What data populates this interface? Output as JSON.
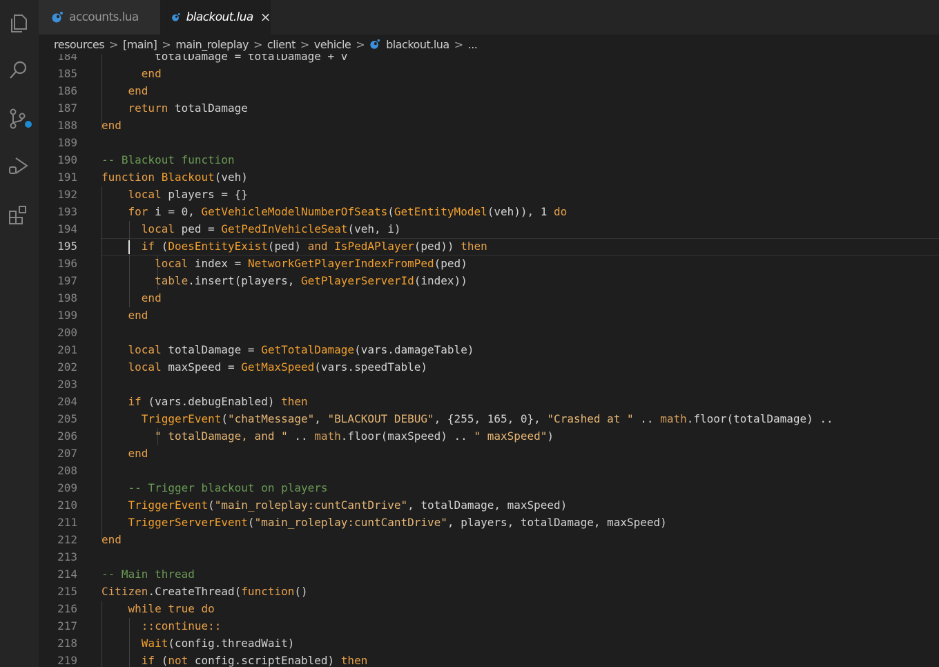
{
  "activity_bar": {
    "icons": [
      "explorer-icon",
      "search-icon",
      "source-control-icon",
      "run-debug-icon",
      "extensions-icon"
    ]
  },
  "tabs": [
    {
      "label": "accounts.lua",
      "active": false
    },
    {
      "label": "blackout.lua",
      "active": true,
      "close": "×"
    }
  ],
  "breadcrumb": {
    "items": [
      "resources",
      "[main]",
      "main_roleplay",
      "client",
      "vehicle",
      "blackout.lua",
      "..."
    ],
    "separator": ">"
  },
  "editor": {
    "current_line": 195,
    "lines": [
      {
        "n": "184",
        "tokens": [
          [
            "",
            "        totalDamage = totalDamage + v"
          ]
        ]
      },
      {
        "n": "185",
        "tokens": [
          [
            "kw",
            "      end"
          ]
        ]
      },
      {
        "n": "186",
        "tokens": [
          [
            "kw",
            "    end"
          ]
        ]
      },
      {
        "n": "187",
        "tokens": [
          [
            "kw",
            "    return"
          ],
          [
            "",
            " totalDamage"
          ]
        ]
      },
      {
        "n": "188",
        "tokens": [
          [
            "kw",
            "end"
          ]
        ]
      },
      {
        "n": "189",
        "tokens": []
      },
      {
        "n": "190",
        "tokens": [
          [
            "cm",
            "-- Blackout function"
          ]
        ]
      },
      {
        "n": "191",
        "tokens": [
          [
            "kw",
            "function"
          ],
          [
            "",
            " "
          ],
          [
            "fn",
            "Blackout"
          ],
          [
            "",
            "(veh)"
          ]
        ]
      },
      {
        "n": "192",
        "tokens": [
          [
            "kw",
            "    local"
          ],
          [
            "",
            " players = {}"
          ]
        ]
      },
      {
        "n": "193",
        "tokens": [
          [
            "kw",
            "    for"
          ],
          [
            "",
            " i = 0, "
          ],
          [
            "fn",
            "GetVehicleModelNumberOfSeats"
          ],
          [
            "",
            "("
          ],
          [
            "fn",
            "GetEntityModel"
          ],
          [
            "",
            "(veh)), 1 "
          ],
          [
            "kw",
            "do"
          ]
        ]
      },
      {
        "n": "194",
        "tokens": [
          [
            "kw",
            "      local"
          ],
          [
            "",
            " ped = "
          ],
          [
            "fn",
            "GetPedInVehicleSeat"
          ],
          [
            "",
            "(veh, i)"
          ]
        ]
      },
      {
        "n": "195",
        "tokens": [
          [
            "kw",
            "      if"
          ],
          [
            "",
            " ("
          ],
          [
            "fn",
            "DoesEntityExist"
          ],
          [
            "",
            "(ped) "
          ],
          [
            "kw",
            "and"
          ],
          [
            "",
            " "
          ],
          [
            "fn",
            "IsPedAPlayer"
          ],
          [
            "",
            "(ped)) "
          ],
          [
            "kw",
            "then"
          ]
        ]
      },
      {
        "n": "196",
        "tokens": [
          [
            "kw",
            "        local"
          ],
          [
            "",
            " index = "
          ],
          [
            "fn",
            "NetworkGetPlayerIndexFromPed"
          ],
          [
            "",
            "(ped)"
          ]
        ]
      },
      {
        "n": "197",
        "tokens": [
          [
            "bt",
            "        table"
          ],
          [
            "",
            ".insert(players, "
          ],
          [
            "fn",
            "GetPlayerServerId"
          ],
          [
            "",
            "(index))"
          ]
        ]
      },
      {
        "n": "198",
        "tokens": [
          [
            "kw",
            "      end"
          ]
        ]
      },
      {
        "n": "199",
        "tokens": [
          [
            "kw",
            "    end"
          ]
        ]
      },
      {
        "n": "200",
        "tokens": []
      },
      {
        "n": "201",
        "tokens": [
          [
            "kw",
            "    local"
          ],
          [
            "",
            " totalDamage = "
          ],
          [
            "fn",
            "GetTotalDamage"
          ],
          [
            "",
            "(vars.damageTable)"
          ]
        ]
      },
      {
        "n": "202",
        "tokens": [
          [
            "kw",
            "    local"
          ],
          [
            "",
            " maxSpeed = "
          ],
          [
            "fn",
            "GetMaxSpeed"
          ],
          [
            "",
            "(vars.speedTable)"
          ]
        ]
      },
      {
        "n": "203",
        "tokens": []
      },
      {
        "n": "204",
        "tokens": [
          [
            "kw",
            "    if"
          ],
          [
            "",
            " (vars.debugEnabled) "
          ],
          [
            "kw",
            "then"
          ]
        ]
      },
      {
        "n": "205",
        "tokens": [
          [
            "fn",
            "      TriggerEvent"
          ],
          [
            "",
            "("
          ],
          [
            "st",
            "\"chatMessage\""
          ],
          [
            "",
            ", "
          ],
          [
            "st",
            "\"BLACKOUT DEBUG\""
          ],
          [
            "",
            ", {255, 165, 0}, "
          ],
          [
            "st",
            "\"Crashed at \""
          ],
          [
            "",
            " .. "
          ],
          [
            "bt",
            "math"
          ],
          [
            "",
            ".floor(totalDamage) .."
          ]
        ]
      },
      {
        "n": "206",
        "tokens": [
          [
            "st",
            "        \" totalDamage, and \""
          ],
          [
            "",
            " .. "
          ],
          [
            "bt",
            "math"
          ],
          [
            "",
            ".floor(maxSpeed) .. "
          ],
          [
            "st",
            "\" maxSpeed\""
          ],
          [
            "",
            ")"
          ]
        ]
      },
      {
        "n": "207",
        "tokens": [
          [
            "kw",
            "    end"
          ]
        ]
      },
      {
        "n": "208",
        "tokens": []
      },
      {
        "n": "209",
        "tokens": [
          [
            "cm",
            "    -- Trigger blackout on players"
          ]
        ]
      },
      {
        "n": "210",
        "tokens": [
          [
            "fn",
            "    TriggerEvent"
          ],
          [
            "",
            "("
          ],
          [
            "st",
            "\"main_roleplay:cuntCantDrive\""
          ],
          [
            "",
            ", totalDamage, maxSpeed)"
          ]
        ]
      },
      {
        "n": "211",
        "tokens": [
          [
            "fn",
            "    TriggerServerEvent"
          ],
          [
            "",
            "("
          ],
          [
            "st",
            "\"main_roleplay:cuntCantDrive\""
          ],
          [
            "",
            ", players, totalDamage, maxSpeed)"
          ]
        ]
      },
      {
        "n": "212",
        "tokens": [
          [
            "kw",
            "end"
          ]
        ]
      },
      {
        "n": "213",
        "tokens": []
      },
      {
        "n": "214",
        "tokens": [
          [
            "cm",
            "-- Main thread"
          ]
        ]
      },
      {
        "n": "215",
        "tokens": [
          [
            "bt",
            "Citizen"
          ],
          [
            "",
            ".CreateThread("
          ],
          [
            "kw",
            "function"
          ],
          [
            "",
            "()"
          ]
        ]
      },
      {
        "n": "216",
        "tokens": [
          [
            "kw",
            "    while"
          ],
          [
            "",
            " "
          ],
          [
            "kw",
            "true"
          ],
          [
            "",
            " "
          ],
          [
            "kw",
            "do"
          ]
        ]
      },
      {
        "n": "217",
        "tokens": [
          [
            "kw",
            "      ::continue::"
          ]
        ]
      },
      {
        "n": "218",
        "tokens": [
          [
            "fn",
            "      Wait"
          ],
          [
            "",
            "(config.threadWait)"
          ]
        ]
      },
      {
        "n": "219",
        "tokens": [
          [
            "kw",
            "      if"
          ],
          [
            "",
            " ("
          ],
          [
            "kw",
            "not"
          ],
          [
            "",
            " config.scriptEnabled) "
          ],
          [
            "kw",
            "then"
          ]
        ]
      }
    ]
  },
  "colors": {
    "background": "#1e1e1e",
    "sidebar": "#252526",
    "keyword": "#e8a14a",
    "function": "#f2a02e",
    "comment": "#6a9955",
    "string": "#e8b775",
    "accent_blue": "#1f8ad2"
  }
}
